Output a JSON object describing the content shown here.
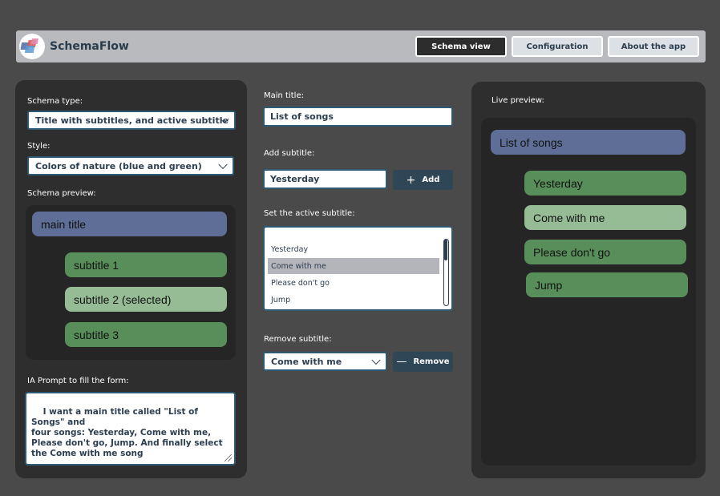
{
  "app": {
    "name": "SchemaFlow",
    "nav": [
      "Schema view",
      "Configuration",
      "About the app"
    ],
    "active_nav": "Schema view"
  },
  "left": {
    "schema_type_label": "Schema type:",
    "schema_type_value": "Title with subtitles, and active subtitle",
    "style_label": "Style:",
    "style_value": "Colors of nature (blue and green)",
    "preview_label": "Schema preview:",
    "preview": {
      "main": "main title",
      "subtitles": [
        "subtitle 1",
        "subtitle 2 (selected)",
        "subtitle 3"
      ]
    },
    "prompt_label": "IA Prompt to fill the form:",
    "prompt_text": "I want a main title called \"List of Songs\" and\nfour songs: Yesterday, Come with me,\nPlease don't go, Jump. And finally select\nthe Come with me song"
  },
  "middle": {
    "main_title_label": "Main title:",
    "main_title_value": "List of songs",
    "add_subtitle_label": "Add subtitle:",
    "add_subtitle_value": "Yesterday",
    "add_button": "Add",
    "active_label": "Set the active subtitle:",
    "active_options": [
      "Yesterday",
      "Come with me",
      "Please don't go",
      "Jump"
    ],
    "active_selected": "Come with me",
    "remove_label": "Remove subtitle:",
    "remove_value": "Come with me",
    "remove_button": "Remove"
  },
  "right": {
    "live_label": "Live preview:",
    "main": "List of songs",
    "subtitles": [
      "Yesterday",
      "Come with me",
      "Please don't go",
      "Jump"
    ],
    "selected": "Come with me"
  },
  "colors": {
    "background": "#4a4a4a",
    "panel": "#2e2e2e",
    "main_title": "#5e6e96",
    "subtitle": "#588e59",
    "subtitle_selected": "#95bc95",
    "button_dark": "#2f4656",
    "border": "#2e5a74"
  }
}
